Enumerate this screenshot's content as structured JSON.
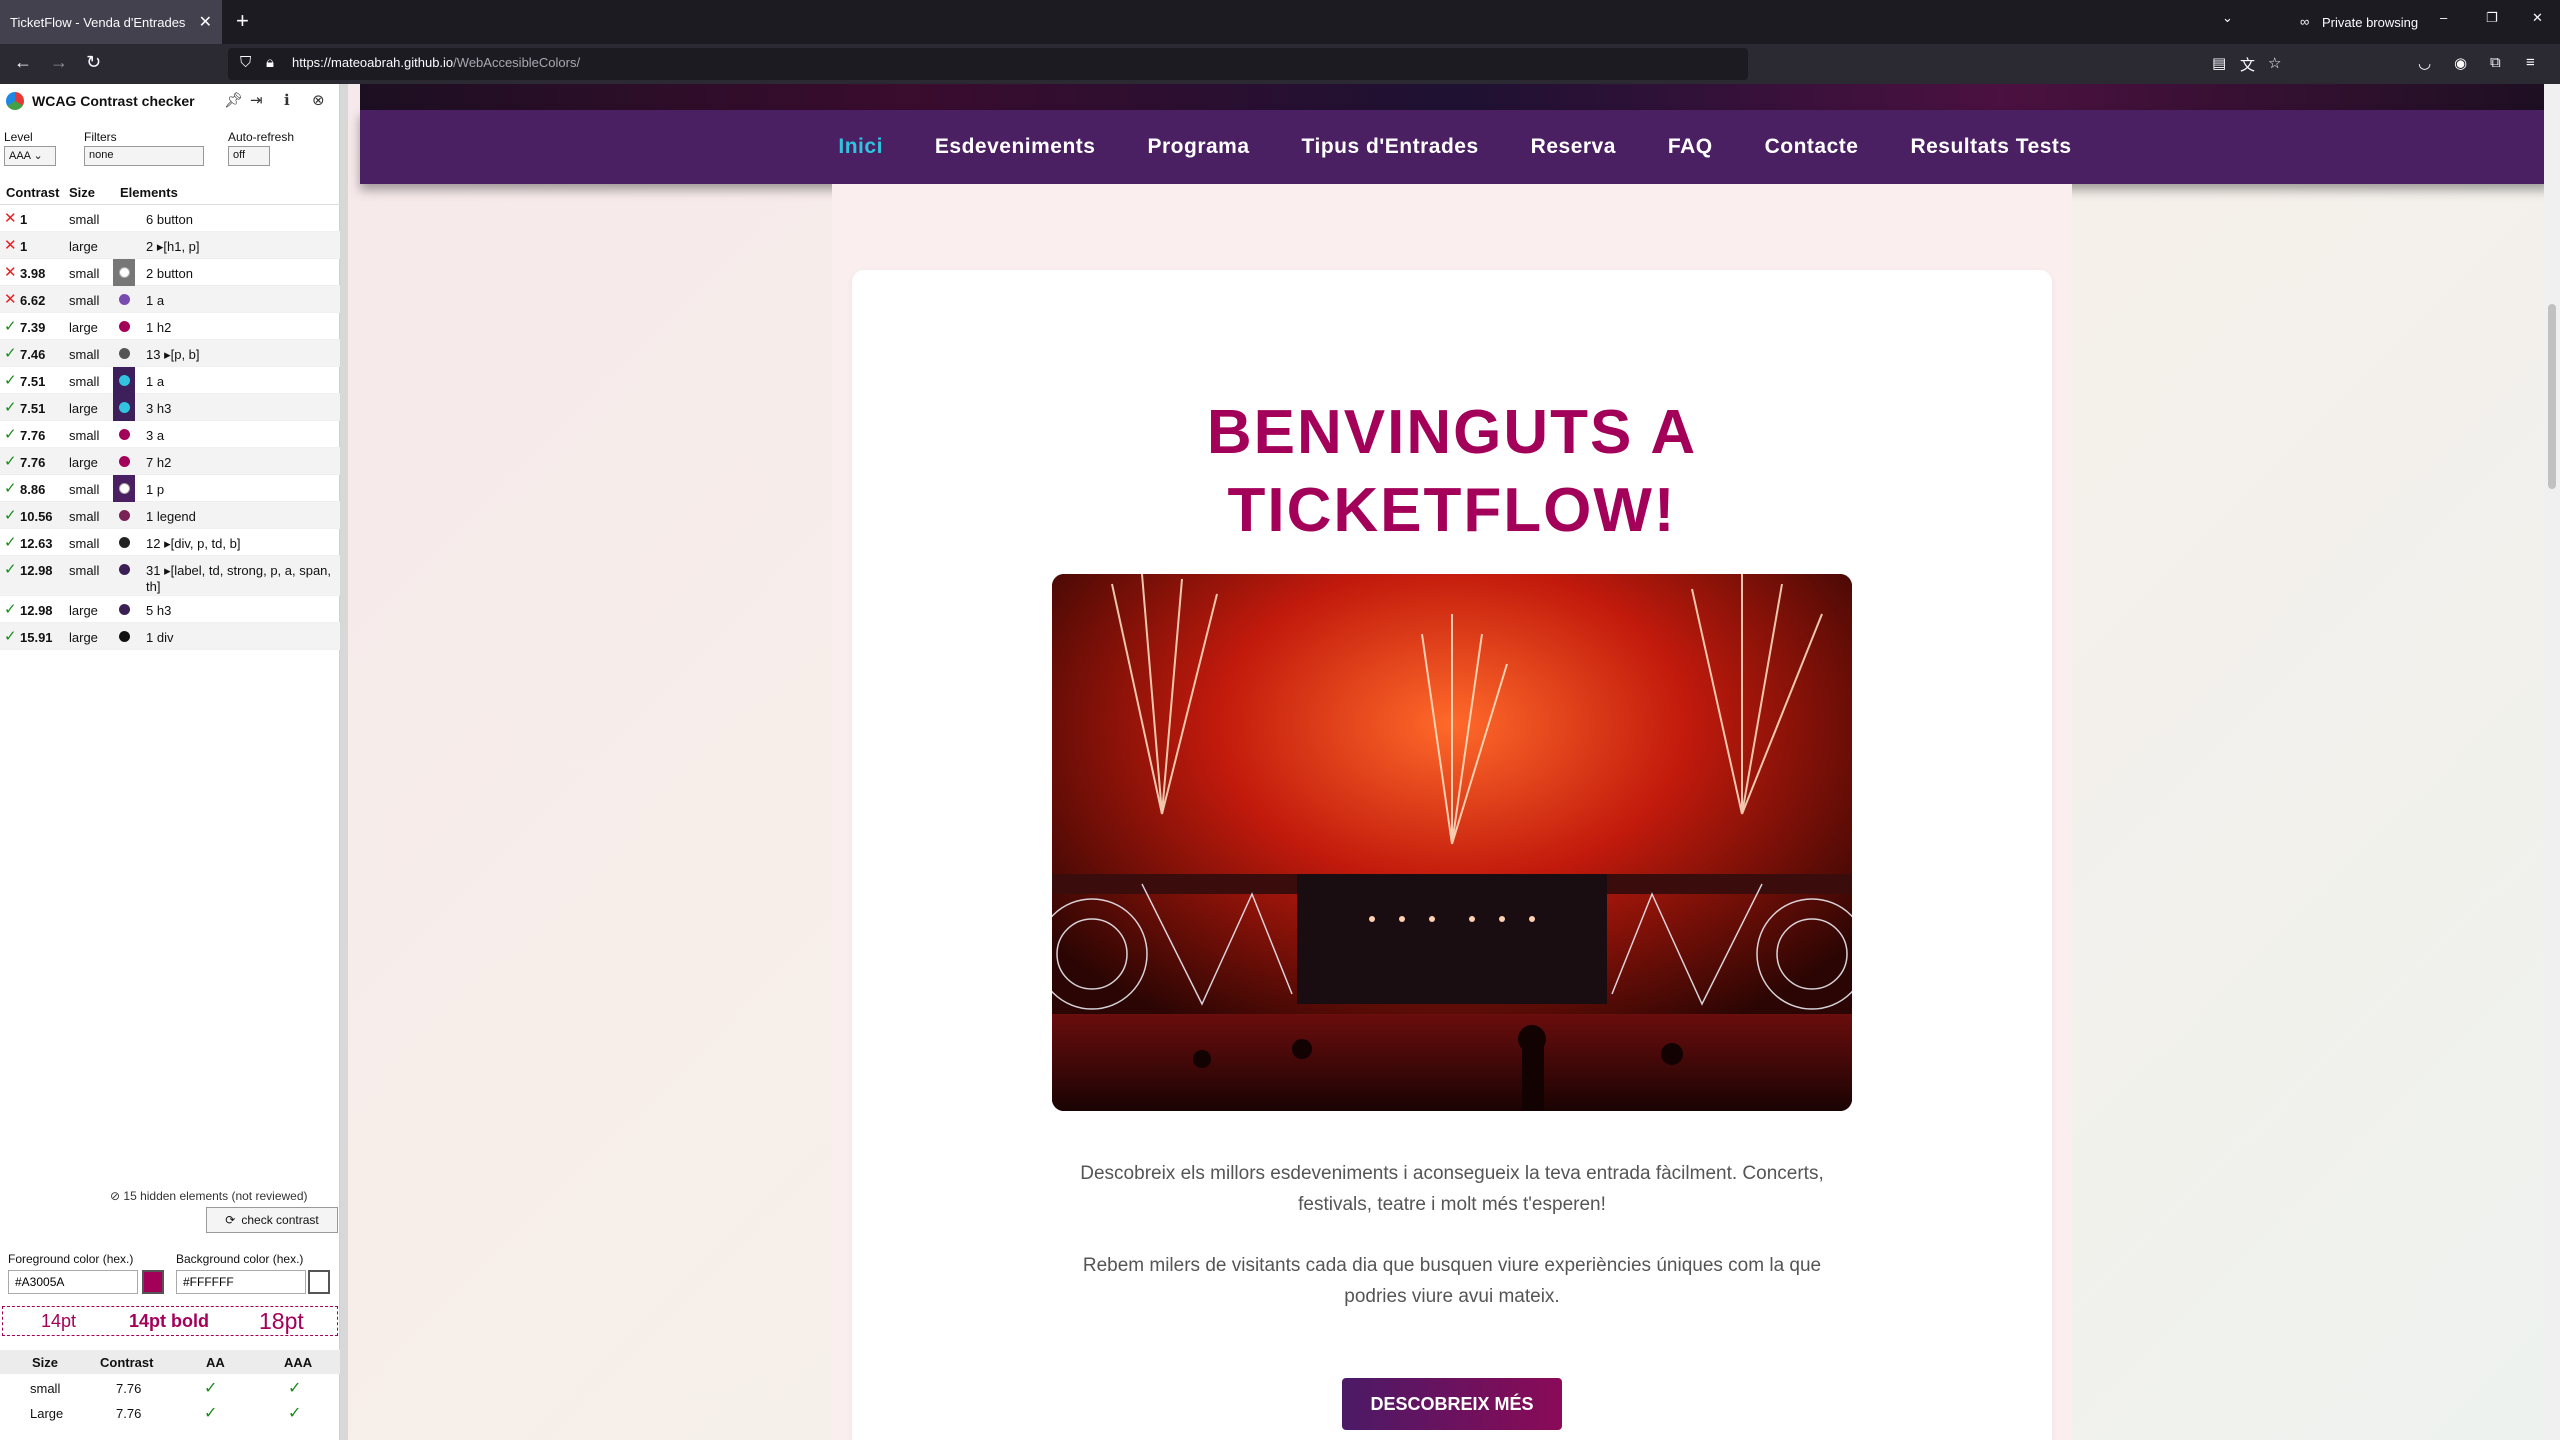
{
  "browser": {
    "tab_title": "TicketFlow - Venda d'Entrades",
    "tab_close": "✕",
    "new_tab": "+",
    "private_label": "Private browsing",
    "url_host": "https://mateoabrah.github.io",
    "url_path": "/WebAccesibleColors/"
  },
  "panel": {
    "title": "WCAG Contrast checker",
    "level_label": "Level",
    "level_value": "AAA",
    "filters_label": "Filters",
    "filters_value": "none",
    "autorefresh_label": "Auto-refresh",
    "autorefresh_value": "off",
    "col_contrast": "Contrast",
    "col_size": "Size",
    "col_elements": "Elements",
    "rows": [
      {
        "status": "fail",
        "ratio": "1",
        "size": "small",
        "swatch": "",
        "dot": "",
        "elements": "6 button"
      },
      {
        "status": "fail",
        "ratio": "1",
        "size": "large",
        "swatch": "",
        "dot": "",
        "elements": "2 ▸[h1, p]"
      },
      {
        "status": "fail",
        "ratio": "3.98",
        "size": "small",
        "swatch": "#777777",
        "dot": "#ffffff",
        "elements": "2 button"
      },
      {
        "status": "fail",
        "ratio": "6.62",
        "size": "small",
        "swatch": "",
        "dot": "#7a4bb0",
        "elements": "1 a"
      },
      {
        "status": "pass",
        "ratio": "7.39",
        "size": "large",
        "swatch": "",
        "dot": "#a3005a",
        "elements": "1 h2"
      },
      {
        "status": "pass",
        "ratio": "7.46",
        "size": "small",
        "swatch": "",
        "dot": "#555555",
        "elements": "13 ▸[p, b]"
      },
      {
        "status": "pass",
        "ratio": "7.51",
        "size": "small",
        "swatch": "#3d1f5c",
        "dot": "#30c4e0",
        "elements": "1 a"
      },
      {
        "status": "pass",
        "ratio": "7.51",
        "size": "large",
        "swatch": "#3d1f5c",
        "dot": "#30c4e0",
        "elements": "3 h3"
      },
      {
        "status": "pass",
        "ratio": "7.76",
        "size": "small",
        "swatch": "",
        "dot": "#a3005a",
        "elements": "3 a"
      },
      {
        "status": "pass",
        "ratio": "7.76",
        "size": "large",
        "swatch": "",
        "dot": "#a3005a",
        "elements": "7 h2"
      },
      {
        "status": "pass",
        "ratio": "8.86",
        "size": "small",
        "swatch": "#4b2063",
        "dot": "#ffffff",
        "elements": "1 p"
      },
      {
        "status": "pass",
        "ratio": "10.56",
        "size": "small",
        "swatch": "",
        "dot": "#7a2255",
        "elements": "1 legend"
      },
      {
        "status": "pass",
        "ratio": "12.63",
        "size": "small",
        "swatch": "",
        "dot": "#222222",
        "elements": "12 ▸[div, p, td, b]"
      },
      {
        "status": "pass",
        "ratio": "12.98",
        "size": "small",
        "swatch": "",
        "dot": "#3a1f55",
        "elements": "31 ▸[label, td, strong, p, a, span, th]"
      },
      {
        "status": "pass",
        "ratio": "12.98",
        "size": "large",
        "swatch": "",
        "dot": "#3a1f55",
        "elements": "5 h3"
      },
      {
        "status": "pass",
        "ratio": "15.91",
        "size": "large",
        "swatch": "",
        "dot": "#111111",
        "elements": "1 div"
      }
    ],
    "hidden_info": "15 hidden elements (not reviewed)",
    "check_button": "check contrast",
    "fg_label": "Foreground color (hex.)",
    "fg_value": "#A3005A",
    "fg_color": "#A3005A",
    "bg_label": "Background color (hex.)",
    "bg_value": "#FFFFFF",
    "bg_color": "#FFFFFF",
    "preview_14": "14pt",
    "preview_14b": "14pt bold",
    "preview_18": "18pt",
    "res_size": "Size",
    "res_contrast": "Contrast",
    "res_aa": "AA",
    "res_aaa": "AAA",
    "results": [
      {
        "size": "small",
        "contrast": "7.76",
        "aa": "✓",
        "aaa": "✓"
      },
      {
        "size": "Large",
        "contrast": "7.76",
        "aa": "✓",
        "aaa": "✓"
      }
    ]
  },
  "site": {
    "nav": [
      "Inici",
      "Esdeveniments",
      "Programa",
      "Tipus d'Entrades",
      "Reserva",
      "FAQ",
      "Contacte",
      "Resultats Tests"
    ],
    "active_nav": "Inici",
    "headline_1": "BENVINGUTS A",
    "headline_2": "TICKETFLOW!",
    "para_1": "Descobreix els millors esdeveniments i aconsegueix la teva entrada fàcilment. Concerts, festivals, teatre i molt més t'esperen!",
    "para_2": "Rebem milers de visitants cada dia que busquen viure experiències úniques com la que podries viure avui mateix.",
    "cta": "DESCOBREIX MÉS",
    "colors": {
      "nav_bg": "#4b2063",
      "active": "#30c4e0",
      "headline": "#a3005a"
    }
  }
}
